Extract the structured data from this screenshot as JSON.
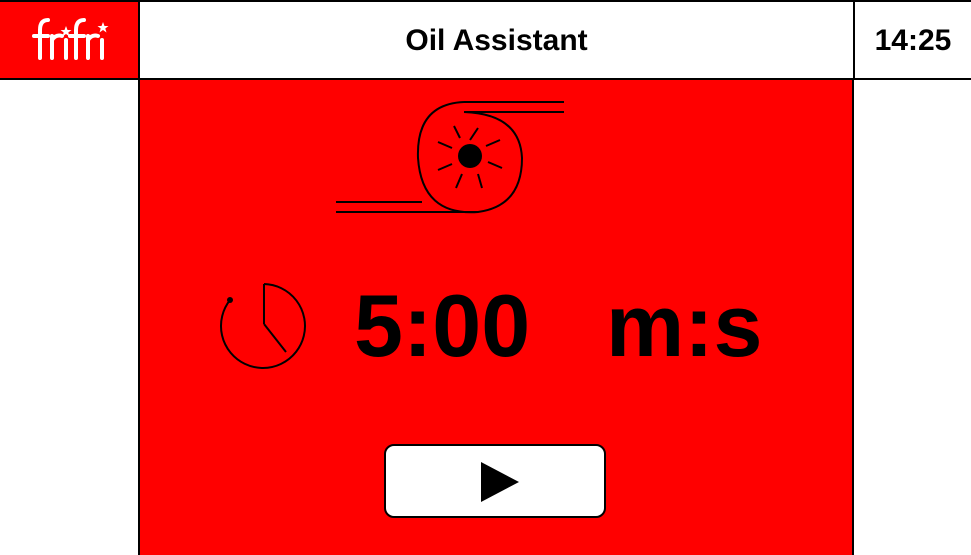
{
  "header": {
    "logo_text": "frifri",
    "title": "Oil Assistant",
    "time": "14:25"
  },
  "panel": {
    "fan_icon": "fan-blower-icon",
    "timer_icon": "stopwatch-icon",
    "timer_value": "5:00",
    "timer_unit": "m:s",
    "play_icon": "play-icon"
  },
  "colors": {
    "panel_background": "#ff0000",
    "logo_background": "#ff0000",
    "text": "#000000",
    "button_background": "#ffffff"
  }
}
